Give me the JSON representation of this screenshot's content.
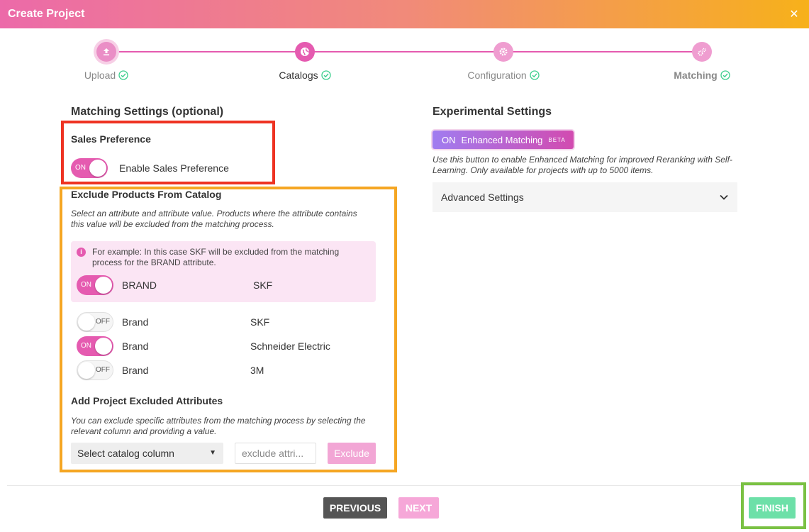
{
  "header": {
    "title": "Create Project",
    "close": "✕"
  },
  "stepper": {
    "steps": [
      {
        "label": "Upload",
        "icon": "upload-icon"
      },
      {
        "label": "Catalogs",
        "icon": "globe-icon"
      },
      {
        "label": "Configuration",
        "icon": "gear-icon"
      },
      {
        "label": "Matching",
        "icon": "gears-icon"
      }
    ]
  },
  "matching": {
    "title": "Matching Settings (optional)",
    "sales_title": "Sales Preference",
    "sales_toggle_state": "ON",
    "sales_toggle_label": "Enable Sales Preference",
    "exclude_title": "Exclude Products From Catalog",
    "exclude_desc": "Select an attribute and attribute value. Products where the attribute contains this value will be excluded from the matching process.",
    "example": {
      "text": "For example: In this case SKF will be excluded from the matching process for the BRAND attribute.",
      "toggle_state": "ON",
      "attribute": "BRAND",
      "value": "SKF"
    },
    "rows": [
      {
        "state": "OFF",
        "attribute": "Brand",
        "value": "SKF"
      },
      {
        "state": "ON",
        "attribute": "Brand",
        "value": "Schneider Electric"
      },
      {
        "state": "OFF",
        "attribute": "Brand",
        "value": "3M"
      }
    ],
    "add_title": "Add Project Excluded Attributes",
    "add_desc": "You can exclude specific attributes from the matching process by selecting the relevant column and providing a value.",
    "select_value": "Select catalog column",
    "input_placeholder": "exclude attri...",
    "exclude_button": "Exclude"
  },
  "experimental": {
    "title": "Experimental Settings",
    "enhanced_state": "ON",
    "enhanced_label": "Enhanced Matching",
    "beta": "BETA",
    "enhanced_desc": "Use this button to enable Enhanced Matching for improved Reranking with Self-Learning. Only available for projects with up to 5000 items.",
    "advanced_label": "Advanced Settings"
  },
  "footer": {
    "previous": "PREVIOUS",
    "next": "NEXT",
    "finish": "FINISH"
  },
  "colors": {
    "accent": "#e55bb0",
    "success": "#6de0a8",
    "annotation_red": "#ee3322",
    "annotation_orange": "#f5a623",
    "annotation_green": "#7ac143"
  }
}
